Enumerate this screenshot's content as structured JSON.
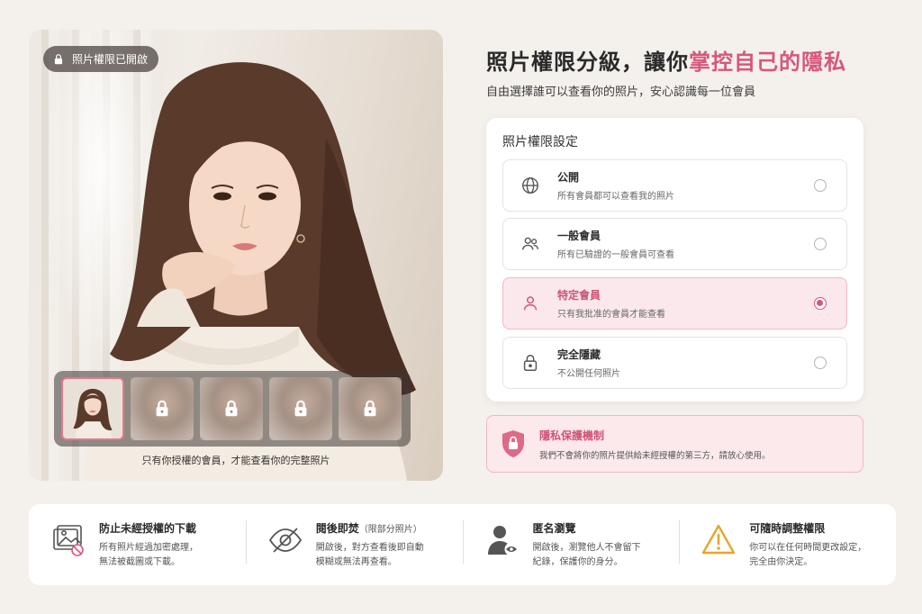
{
  "photo": {
    "lock_badge": "照片權限已開啟",
    "strip_caption": "只有你授權的會員，才能查看你的完整照片",
    "thumbnails": [
      {
        "state": "unlocked"
      },
      {
        "state": "locked"
      },
      {
        "state": "locked"
      },
      {
        "state": "locked"
      },
      {
        "state": "locked"
      }
    ]
  },
  "headline": {
    "prefix": "照片權限分級，讓你",
    "accent": "掌控自己的隱私",
    "accent_color": "#d6577a"
  },
  "subhead": "自由選擇誰可以查看你的照片，安心認識每一位會員",
  "settings": {
    "title": "照片權限設定",
    "options": [
      {
        "label": "公開",
        "desc": "所有會員都可以查看我的照片",
        "icon": "globe-icon",
        "selected": false
      },
      {
        "label": "一般會員",
        "desc": "所有已驗證的一般會員可查看",
        "icon": "users-icon",
        "selected": false
      },
      {
        "label": "特定會員",
        "desc": "只有我批准的會員才能查看",
        "icon": "user-icon",
        "selected": true
      },
      {
        "label": "完全隱藏",
        "desc": "不公開任何照片",
        "icon": "lock-icon",
        "selected": false
      }
    ]
  },
  "privacy": {
    "title": "隱私保護機制",
    "desc": "我們不會將你的照片提供給未經授權的第三方，請放心使用。",
    "icon": "shield-lock-icon"
  },
  "features": [
    {
      "title": "防止未經授權的下載",
      "small": "",
      "desc": "所有照片經過加密處理，\n無法被截圖或下載。",
      "icon": "no-download-image-icon"
    },
    {
      "title": "閱後即焚",
      "small": "（限部分照片）",
      "desc": "開啟後，對方查看後即自動\n模糊或無法再查看。",
      "icon": "eye-off-icon"
    },
    {
      "title": "匿名瀏覽",
      "small": "",
      "desc": "開啟後，瀏覽他人不會留下\n紀錄，保護你的身分。",
      "icon": "anonymous-user-icon"
    },
    {
      "title": "可隨時調整權限",
      "small": "",
      "desc": "你可以在任何時間更改設定，\n完全由你決定。",
      "icon": "warning-icon"
    }
  ]
}
